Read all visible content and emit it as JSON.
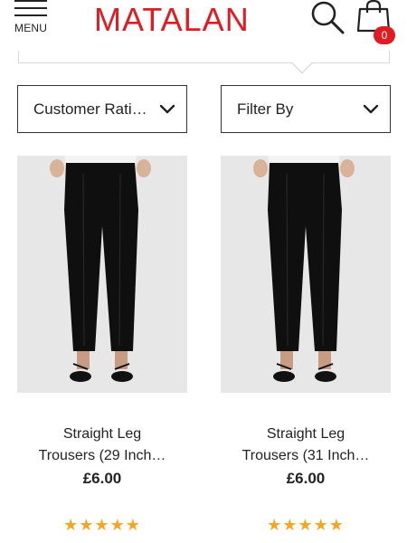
{
  "header": {
    "menu_label": "MENU",
    "logo_text": "MATALAN",
    "bag_count": "0",
    "brand_color": "#e01b22"
  },
  "sort_dropdown": {
    "label": "Customer Rati…"
  },
  "filter_dropdown": {
    "label": "Filter By"
  },
  "products": [
    {
      "name_line1": "Straight Leg",
      "name_line2": "Trousers (29 Inch…",
      "price": "£6.00",
      "stars": "★★★★★",
      "rating": 5,
      "image": "black-straight-leg-trousers"
    },
    {
      "name_line1": "Straight Leg",
      "name_line2": "Trousers (31 Inch…",
      "price": "£6.00",
      "stars": "★★★★★",
      "rating": 5,
      "image": "black-straight-leg-trousers"
    }
  ],
  "colors": {
    "star": "#f5a623",
    "accent": "#e01b22"
  }
}
